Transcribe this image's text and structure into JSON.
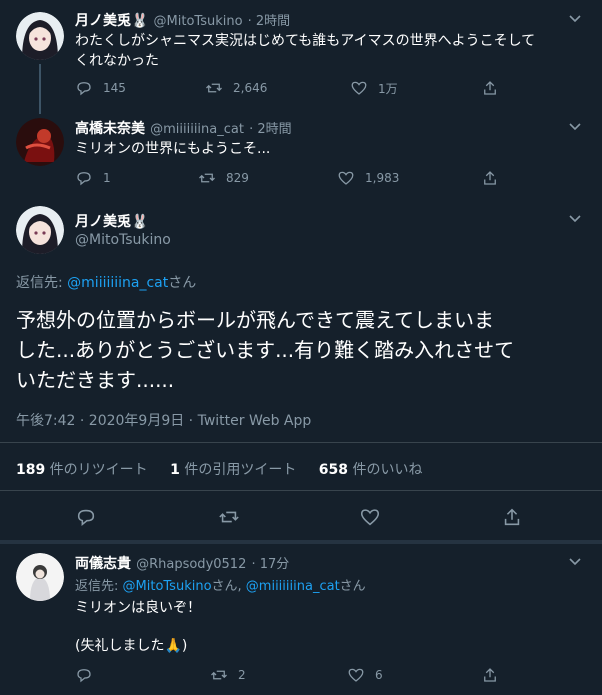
{
  "colors": {
    "background": "#15202b",
    "text": "#ffffff",
    "muted": "#8899a6",
    "accent": "#1da1f2",
    "border": "#38444d"
  },
  "tweet1": {
    "name": "月ノ美兎🐰",
    "handle": "@MitoTsukino",
    "time": "· 2時間",
    "text_line1": "わたくしがシャニマス実況はじめても誰もアイマスの世界へようこそして",
    "text_line2": "くれなかった",
    "replies": "145",
    "retweets": "2,646",
    "likes": "1万"
  },
  "tweet2": {
    "name": "高橋未奈美",
    "handle": "@miiiiiiina_cat",
    "time": "· 2時間",
    "text": "ミリオンの世界にもようこそ...",
    "replies": "1",
    "retweets": "829",
    "likes": "1,983"
  },
  "main": {
    "name": "月ノ美兎🐰",
    "handle": "@MitoTsukino",
    "reply_to_prefix": "返信先: ",
    "reply_to_user": "@miiiiiiina_cat",
    "reply_to_suffix": "さん",
    "text_line1": "予想外の位置からボールが飛んできて震えてしまいま",
    "text_line2": "した...ありがとうございます...有り難く踏み入れさせて",
    "text_line3": "いただきます......",
    "timestamp": "午後7:42 · 2020年9月9日 · Twitter Web App",
    "stats": [
      {
        "num": "189",
        "label": " 件のリツイート"
      },
      {
        "num": "1",
        "label": " 件の引用ツイート"
      },
      {
        "num": "658",
        "label": " 件のいいね"
      }
    ]
  },
  "reply": {
    "name": "両儀志貴",
    "handle": "@Rhapsody0512",
    "time": "· 17分",
    "reply_to_prefix": "返信先: ",
    "reply_to_user1": "@MitoTsukino",
    "reply_to_mid": "さん, ",
    "reply_to_user2": "@miiiiiiina_cat",
    "reply_to_suffix": "さん",
    "text_line1": "ミリオンは良いぞ！",
    "text_line2": "(失礼しました🙏)",
    "retweets": "2",
    "likes": "6"
  },
  "icons": [
    "chevron-down-icon",
    "reply-icon",
    "retweet-icon",
    "like-icon",
    "share-icon"
  ]
}
